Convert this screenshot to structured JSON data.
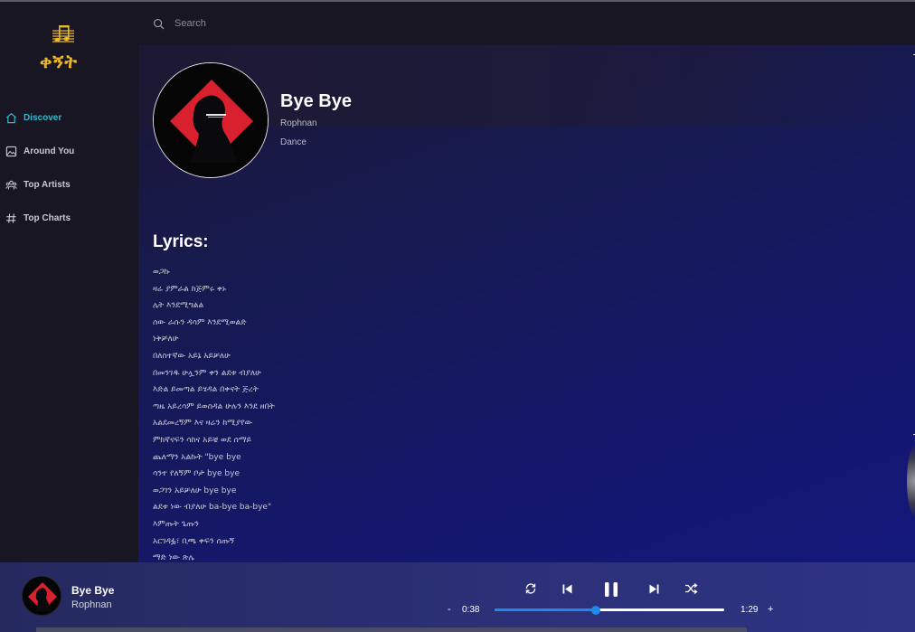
{
  "app": {
    "logo_text": "ቀኝት"
  },
  "sidebar": {
    "items": [
      {
        "label": "Discover",
        "icon": "home-icon",
        "active": true
      },
      {
        "label": "Around You",
        "icon": "image-icon",
        "active": false
      },
      {
        "label": "Top Artists",
        "icon": "users-icon",
        "active": false
      },
      {
        "label": "Top Charts",
        "icon": "hashtag-icon",
        "active": false
      }
    ]
  },
  "search": {
    "placeholder": "Search",
    "value": ""
  },
  "song": {
    "title": "Bye Bye",
    "artist": "Rophnan",
    "genre": "Dance"
  },
  "lyrics": {
    "heading": "Lyrics:",
    "lines": [
      "ወጋኩ",
      "ዛሬ ያምራል ከጅምሩ ቀኑ",
      "ሌት እንደሚግልል",
      "ሰው ራሱን ዳሳም እንደሚወልድ",
      "ነቅቻለሁ",
      "በለስተኛው አይኔ አይቻለሁ",
      "በመንገዱ ሁሏንም ቀን ልደቱ ብያለሁ",
      "እድል ይመጣል ይሄዳል በቀናት ጅረት",
      "ጣዜ አይረሳም ይወስዳል ሁሉን እንደ ዘበት",
      "አልደመረኝም እና ዛሬን ከሚያየው",
      "ምክኛናፍን ሳከና አይቼ ወደ ሰማይ",
      "ጨለማን አልኩት \"bye bye",
      "ሳንተ የለኝም ቦታ bye bye",
      "ወጋገን አይቻለሁ bye bye",
      "ልደቱ ነው ብያለሁ ba-bye ba-bye\"",
      "እምጡት ጌጡን",
      "አርገዳፏ፣ ቢጫ ቀፍን ሰጡኝ",
      "ማድ ነው ጽሌ"
    ]
  },
  "player": {
    "title": "Bye Bye",
    "artist": "Rophnan",
    "current_time": "0:38",
    "total_time": "1:29",
    "progress_fraction": 0.44,
    "minus_label": "-",
    "plus_label": "+",
    "state": "playing"
  },
  "colors": {
    "accent": "#2fb8cc",
    "progress": "#1c8ae8",
    "logo": "#e8b72a",
    "cover_red": "#d9202e"
  }
}
